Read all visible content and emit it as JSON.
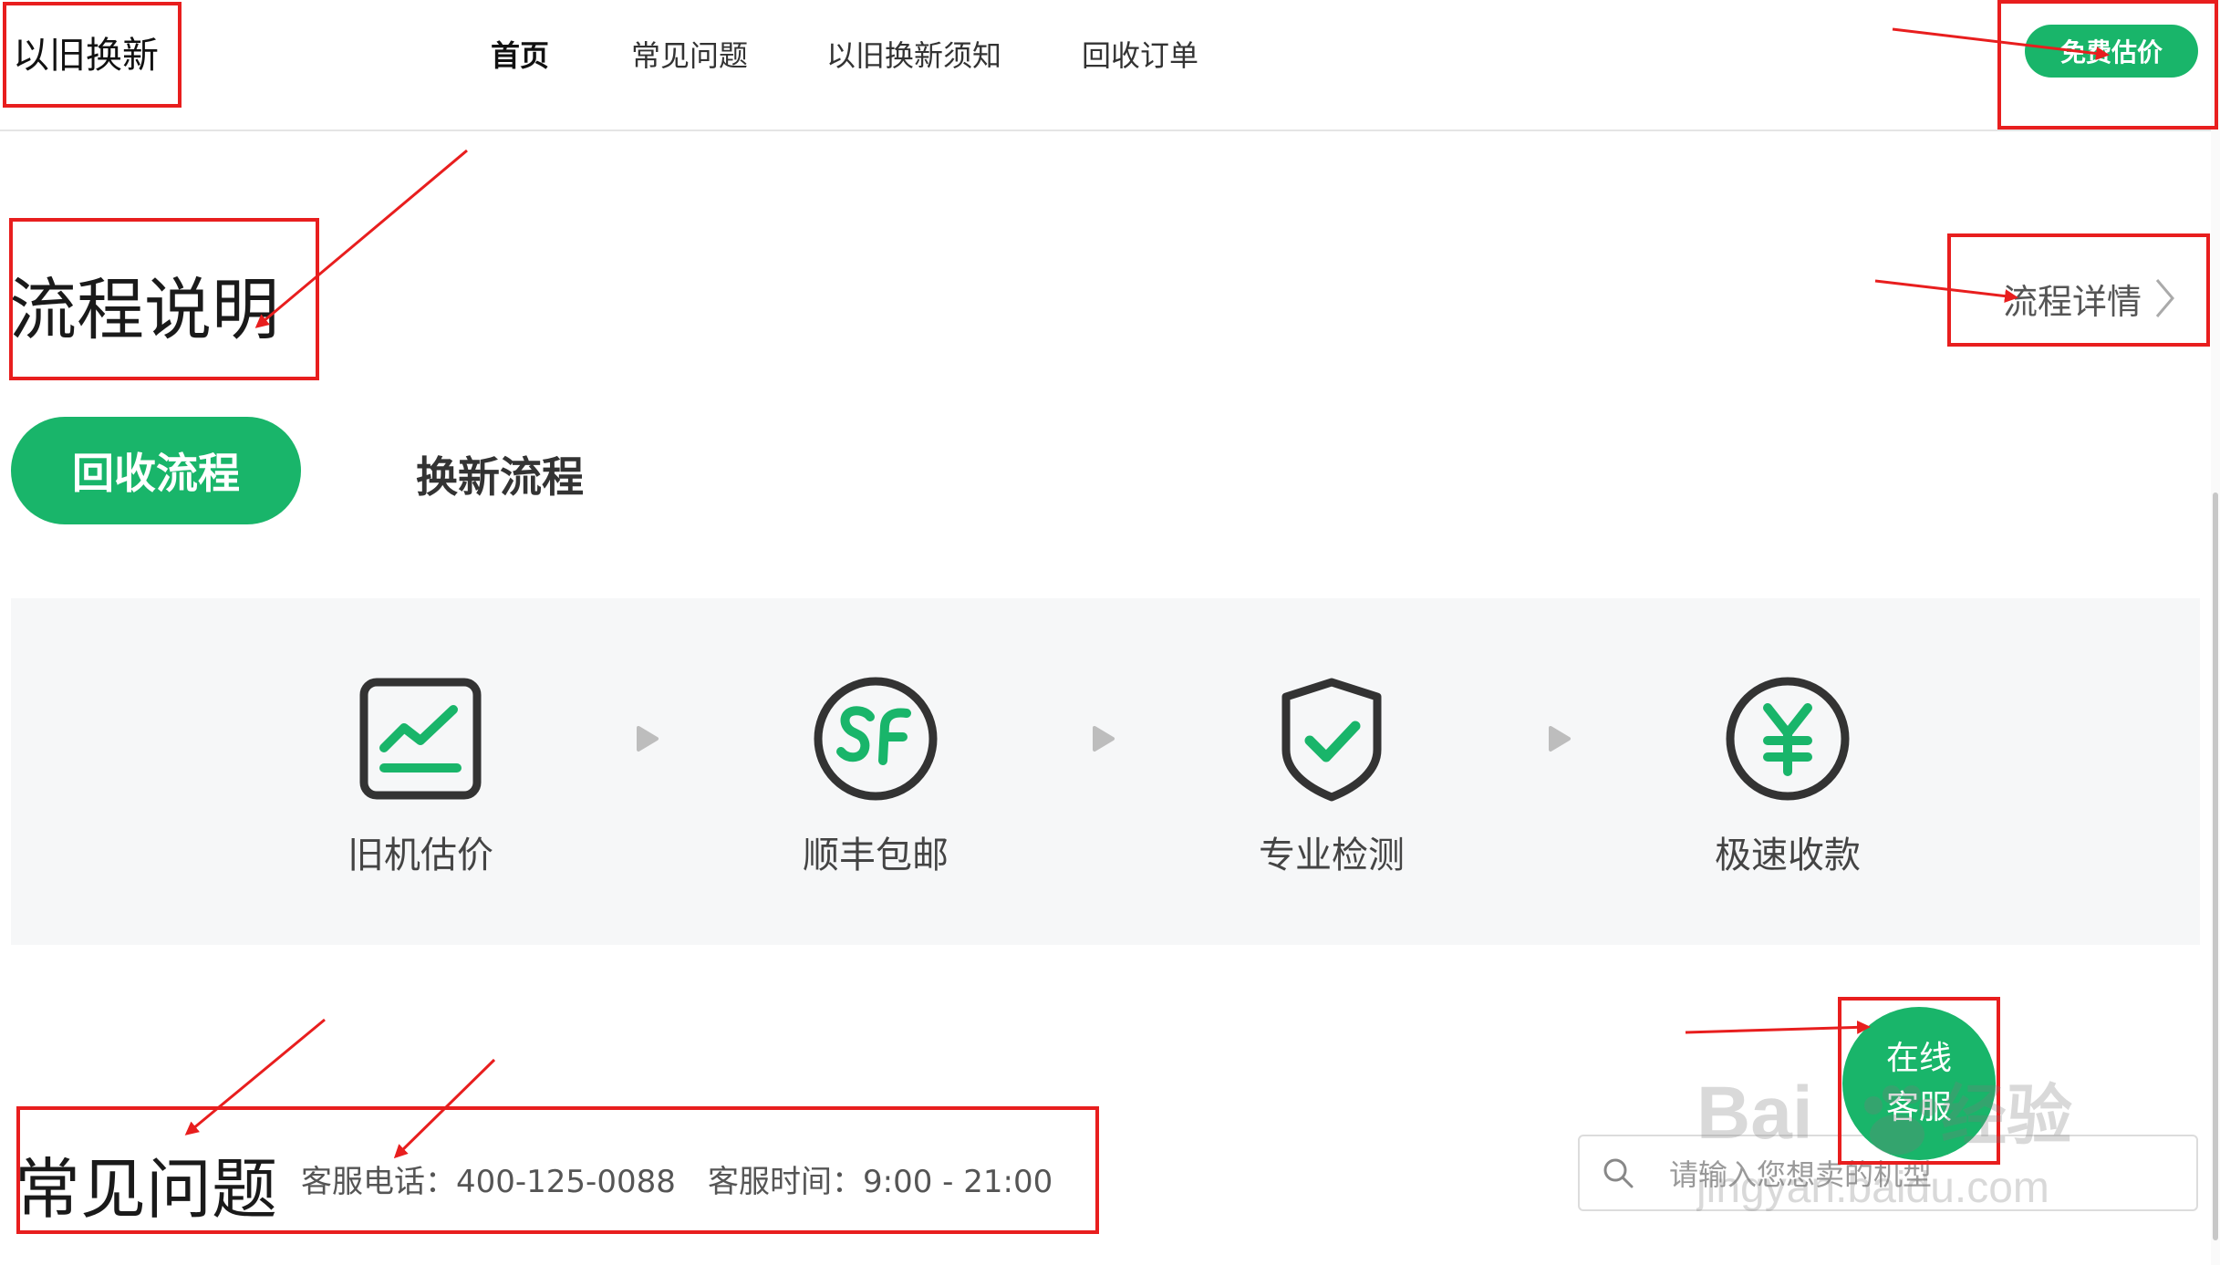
{
  "header": {
    "site_title": "以旧换新",
    "nav": [
      "首页",
      "常见问题",
      "以旧换新须知",
      "回收订单"
    ],
    "free_estimate_label": "免费估价"
  },
  "process": {
    "title": "流程说明",
    "detail_link": "流程详情",
    "tabs": [
      "回收流程",
      "换新流程"
    ],
    "steps": [
      {
        "label": "旧机估价",
        "icon": "chart-trend-icon"
      },
      {
        "label": "顺丰包邮",
        "icon": "sf-express-icon"
      },
      {
        "label": "专业检测",
        "icon": "shield-check-icon"
      },
      {
        "label": "极速收款",
        "icon": "yuan-coin-icon"
      }
    ]
  },
  "faq": {
    "title": "常见问题",
    "phone": "客服电话：400-125-0088",
    "hours": "客服时间：9:00 - 21:00",
    "search_placeholder": "请输入您想卖的机型"
  },
  "online_service": {
    "line1": "在线",
    "line2": "客服"
  },
  "watermark": {
    "brand": "Bai",
    "brand_suffix": "经验",
    "url": "jingyan.baidu.com"
  },
  "colors": {
    "accent": "#19b56a",
    "annotation": "#e81e1e",
    "panel_bg": "#f6f7f8"
  }
}
